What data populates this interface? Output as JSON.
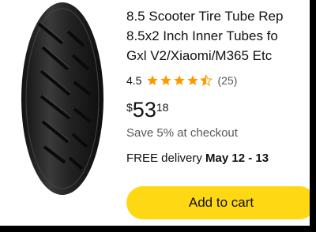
{
  "product": {
    "title_lines": [
      "8.5 Scooter Tire Tube Rep",
      "8.5x2 Inch Inner Tubes fo",
      "Gxl V2/Xiaomi/M365 Etc"
    ],
    "rating": "4.5",
    "review_count": "(25)",
    "price": {
      "symbol": "$",
      "whole": "53",
      "fraction": "18"
    },
    "savings_text": "Save 5% at checkout",
    "delivery_prefix": "FREE delivery",
    "delivery_dates": "May 12 - 13"
  },
  "rating_stars": {
    "value": 4.5,
    "max": 5
  },
  "actions": {
    "add_to_cart_label": "Add to cart"
  },
  "colors": {
    "star": "#FF9900",
    "button": "#FFD814",
    "price_text": "#0F1111",
    "muted": "#565959"
  }
}
